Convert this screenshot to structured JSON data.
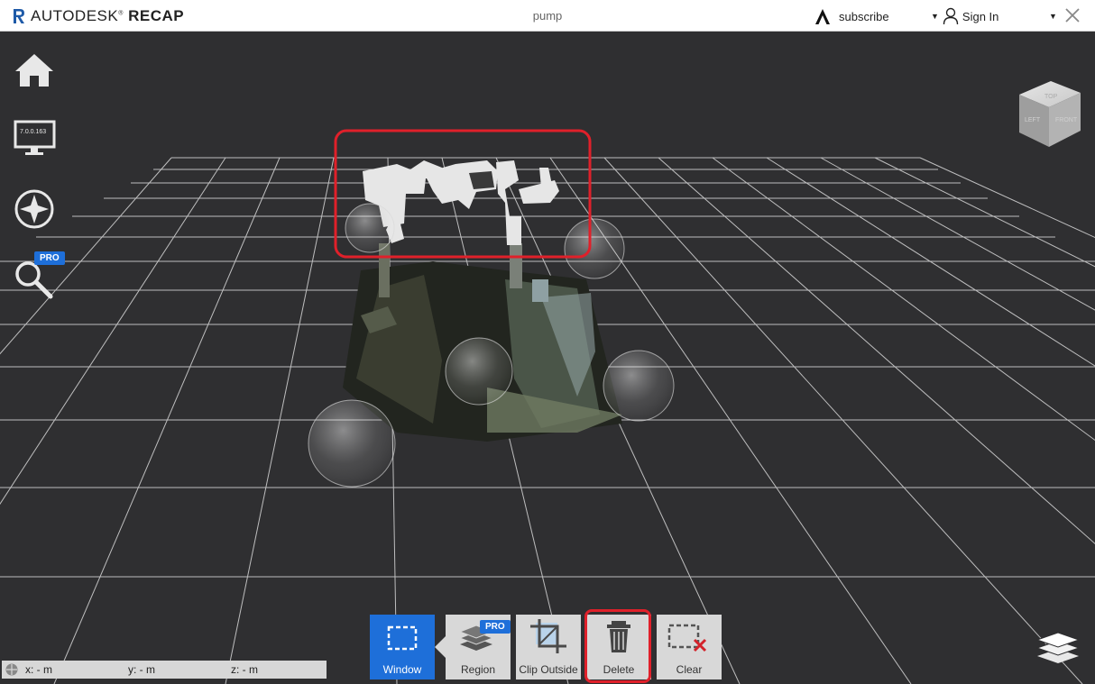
{
  "app": {
    "brand": "AUTODESK",
    "product": "RECAP",
    "document_title": "pump"
  },
  "header": {
    "subscribe_label": "subscribe",
    "signin_label": "Sign In"
  },
  "left_toolbar": {
    "version_label": "7.0.0.163",
    "pro_badge": "PRO"
  },
  "viewcube": {
    "top_label": "TOP",
    "left_label": "LEFT",
    "front_label": "FRONT"
  },
  "bottom_toolbar": {
    "buttons": [
      {
        "label": "Window",
        "active": true
      },
      {
        "label": "Region",
        "pro": "PRO"
      },
      {
        "label": "Clip Outside"
      },
      {
        "label": "Delete"
      },
      {
        "label": "Clear"
      }
    ]
  },
  "coordinates": {
    "x": "x:  -  m",
    "y": "y:  -  m",
    "z": "z:  -  m"
  },
  "colors": {
    "accent": "#1e6fd9",
    "highlight": "#e0202a",
    "background": "#2f2f31"
  }
}
